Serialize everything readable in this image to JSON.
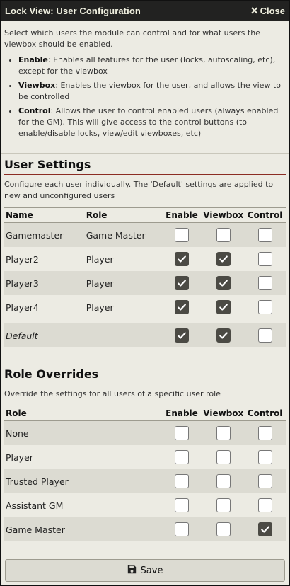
{
  "window": {
    "title": "Lock View: User Configuration",
    "close_label": "Close"
  },
  "intro": {
    "text": "Select which users the module can control and for what users the viewbox should be enabled.",
    "bullets": [
      {
        "term": "Enable",
        "desc": ": Enables all features for the user (locks, autoscaling, etc), except for the viewbox"
      },
      {
        "term": "Viewbox",
        "desc": ": Enables the viewbox for the user, and allows the view to be controlled"
      },
      {
        "term": "Control",
        "desc": ": Allows the user to control enabled users (always enabled for the GM). This will give access to the control buttons (to enable/disable locks, view/edit viewboxes, etc)"
      }
    ]
  },
  "user_settings": {
    "heading": "User Settings",
    "description": "Configure each user individually. The 'Default' settings are applied to new and unconfigured users",
    "columns": {
      "name": "Name",
      "role": "Role",
      "enable": "Enable",
      "viewbox": "Viewbox",
      "control": "Control"
    },
    "rows": [
      {
        "name": "Gamemaster",
        "role": "Game Master",
        "enable": false,
        "viewbox": false,
        "control": false
      },
      {
        "name": "Player2",
        "role": "Player",
        "enable": true,
        "viewbox": true,
        "control": false
      },
      {
        "name": "Player3",
        "role": "Player",
        "enable": true,
        "viewbox": true,
        "control": false
      },
      {
        "name": "Player4",
        "role": "Player",
        "enable": true,
        "viewbox": true,
        "control": false
      }
    ],
    "default_row": {
      "name": "Default",
      "role": "",
      "enable": true,
      "viewbox": true,
      "control": false
    }
  },
  "role_overrides": {
    "heading": "Role Overrides",
    "description": "Override the settings for all users of a specific user role",
    "columns": {
      "role": "Role",
      "enable": "Enable",
      "viewbox": "Viewbox",
      "control": "Control"
    },
    "rows": [
      {
        "role": "None",
        "enable": false,
        "viewbox": false,
        "control": false
      },
      {
        "role": "Player",
        "enable": false,
        "viewbox": false,
        "control": false
      },
      {
        "role": "Trusted Player",
        "enable": false,
        "viewbox": false,
        "control": false
      },
      {
        "role": "Assistant GM",
        "enable": false,
        "viewbox": false,
        "control": false
      },
      {
        "role": "Game Master",
        "enable": false,
        "viewbox": false,
        "control": true
      }
    ]
  },
  "footer": {
    "save_label": "Save",
    "save_icon": "floppy-disk-icon"
  }
}
